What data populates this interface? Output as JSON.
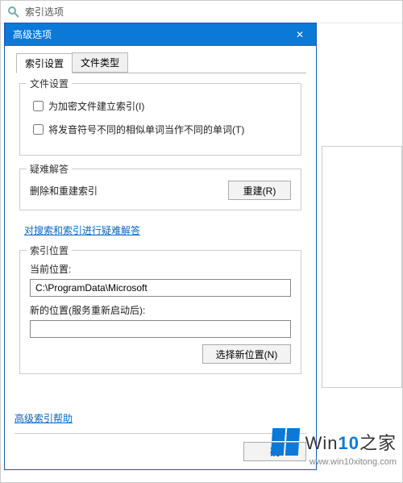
{
  "parentWindow": {
    "title": "索引选项"
  },
  "dialog": {
    "title": "高级选项",
    "closeGlyph": "✕",
    "tabs": {
      "settings": "索引设置",
      "fileTypes": "文件类型"
    },
    "fileSettings": {
      "legend": "文件设置",
      "encryptCheckbox": "为加密文件建立索引(I)",
      "diacriticsCheckbox": "将发音符号不同的相似单词当作不同的单词(T)"
    },
    "troubleshoot": {
      "legend": "疑难解答",
      "deleteRebuildLabel": "删除和重建索引",
      "rebuildButton": "重建(R)",
      "helpLink": "对搜索和索引进行疑难解答"
    },
    "indexLocation": {
      "legend": "索引位置",
      "currentLabel": "当前位置:",
      "currentValue": "C:\\ProgramData\\Microsoft",
      "newLabel": "新的位置(服务重新启动后):",
      "newValue": "",
      "chooseNewButton": "选择新位置(N)"
    },
    "advancedHelpLink": "高级索引帮助",
    "okButton": "确"
  },
  "watermark": {
    "brandPrefix": "Win",
    "brandAccent": "10",
    "brandSuffix": "之家",
    "url": "www.win10xitong.com"
  }
}
